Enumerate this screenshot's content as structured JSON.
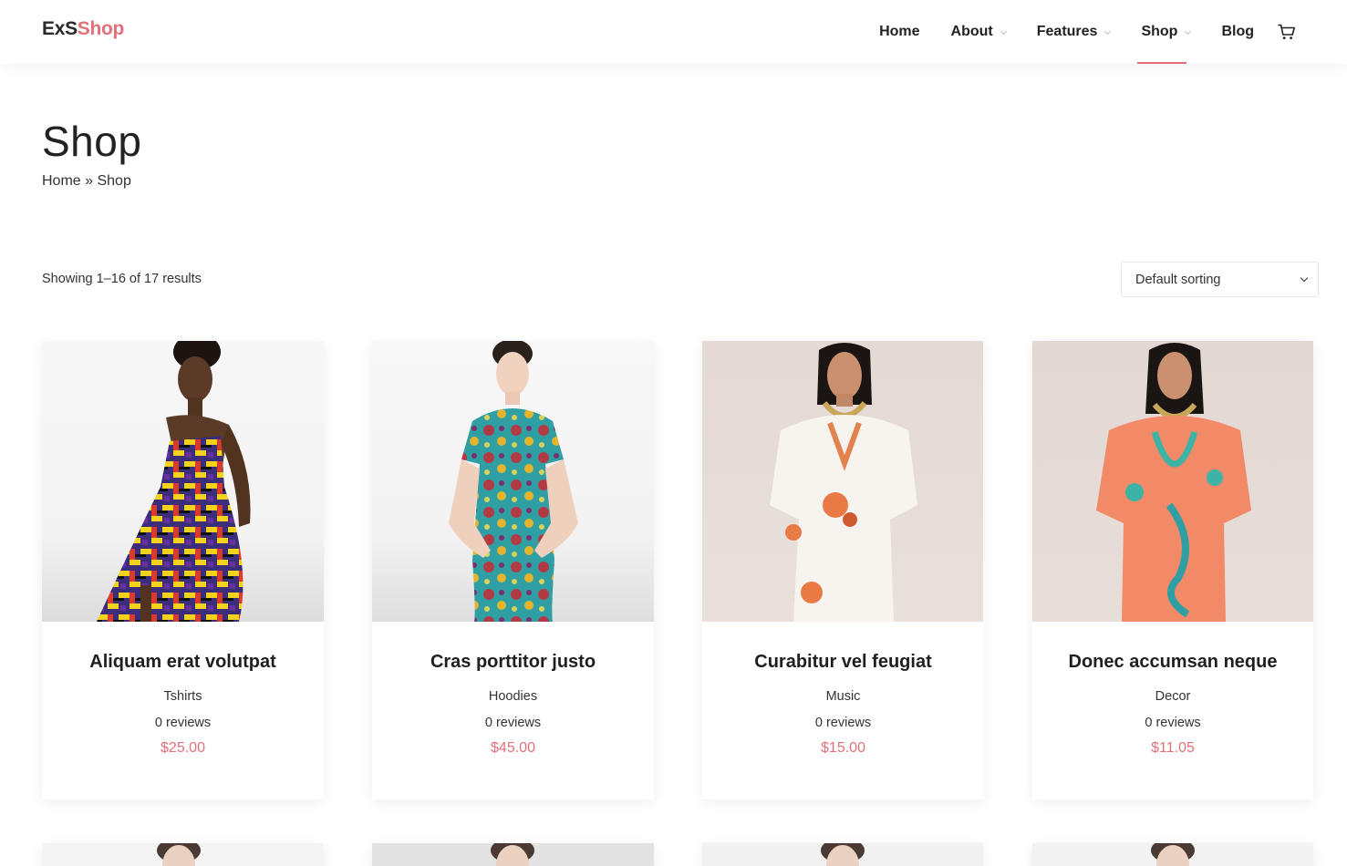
{
  "header": {
    "logo_part1": "ExS",
    "logo_part2": "Shop",
    "nav": [
      {
        "label": "Home"
      },
      {
        "label": "About"
      },
      {
        "label": "Features"
      },
      {
        "label": "Shop"
      },
      {
        "label": "Blog"
      }
    ],
    "accent_color": "#e2707a",
    "cart_icon": "cart-icon"
  },
  "page": {
    "title": "Shop",
    "breadcrumb": {
      "home": "Home",
      "separator": " » ",
      "current": "Shop"
    }
  },
  "toolbar": {
    "result_count": "Showing 1–16 of 17 results",
    "sort_selected": "Default sorting"
  },
  "products": [
    {
      "title": "Aliquam erat volutpat",
      "category": "Tshirts",
      "reviews": "0 reviews",
      "price": "$25.00"
    },
    {
      "title": "Cras porttitor justo",
      "category": "Hoodies",
      "reviews": "0 reviews",
      "price": "$45.00"
    },
    {
      "title": "Curabitur vel feugiat",
      "category": "Music",
      "reviews": "0 reviews",
      "price": "$15.00"
    },
    {
      "title": "Donec accumsan neque",
      "category": "Decor",
      "reviews": "0 reviews",
      "price": "$11.05"
    }
  ]
}
